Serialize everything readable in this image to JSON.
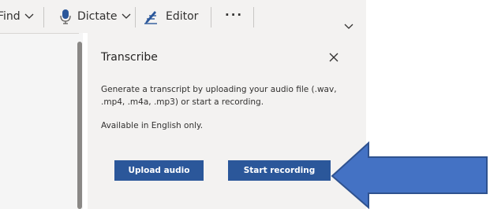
{
  "ribbon": {
    "find_label": "Find",
    "dictate_label": "Dictate",
    "editor_label": "Editor",
    "more_label": "···"
  },
  "transcribe_pane": {
    "title": "Transcribe",
    "description": "Generate a transcript by uploading your audio file (.wav, .mp4, .m4a, .mp3) or start a recording.",
    "availability_note": "Available in English only.",
    "upload_button_label": "Upload audio",
    "record_button_label": "Start recording"
  },
  "icons": {
    "dictate": "microphone-icon",
    "editor": "editor-pen-icon",
    "close": "close-icon",
    "dropdown": "chevron-down-icon",
    "annotation": "arrow-left-icon"
  },
  "colors": {
    "primary_button": "#2b579a",
    "pane_background": "#f3f2f1",
    "annotation_fill": "#4472c4",
    "annotation_stroke": "#2f528f",
    "microphone_blue": "#2b579a"
  }
}
